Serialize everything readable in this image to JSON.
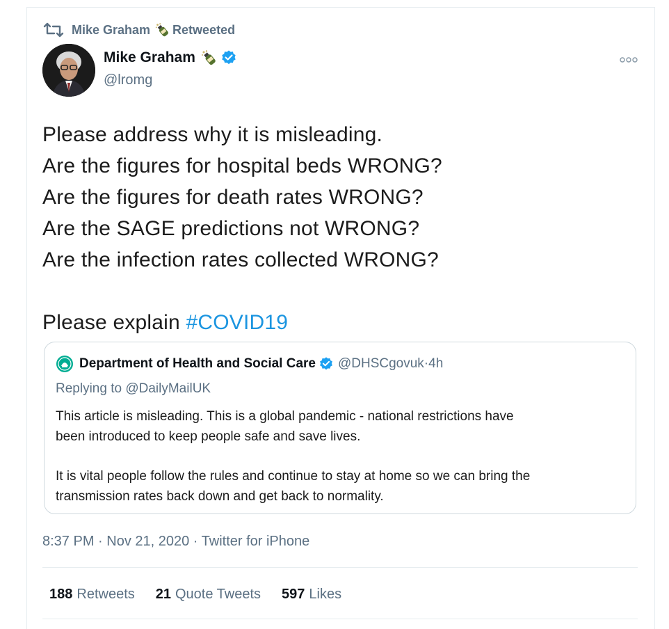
{
  "retweet_context": {
    "name": "Mike Graham",
    "label": "Retweeted"
  },
  "author": {
    "display_name": "Mike Graham",
    "handle": "@lromg"
  },
  "tweet": {
    "lines": [
      "Please address why it is misleading.",
      "Are the figures for hospital beds WRONG?",
      "Are the figures for death rates WRONG?",
      "Are the SAGE predictions not WRONG?",
      "Are the infection rates collected WRONG?"
    ],
    "closing_text": "Please explain ",
    "hashtag": "#COVID19"
  },
  "quoted_tweet": {
    "name": "Department of Health and Social Care",
    "handle": "@DHSCgovuk",
    "separator": " · ",
    "time": "4h",
    "replying_to": "Replying to @DailyMailUK",
    "paragraph1_line1": "This article is misleading. This is a global pandemic - national restrictions have",
    "paragraph1_line2": "been introduced to keep people safe and save lives.",
    "paragraph2_line1": "It is vital people follow the rules and continue to stay at home so we can bring the",
    "paragraph2_line2": "transmission rates back down and get back to normality."
  },
  "timestamp": "8:37 PM · Nov 21, 2020 · Twitter for iPhone",
  "stats": {
    "retweets_count": "188",
    "retweets_label": "Retweets",
    "quotes_count": "21",
    "quotes_label": "Quote Tweets",
    "likes_count": "597",
    "likes_label": "Likes"
  },
  "colors": {
    "accent": "#1b95e0",
    "secondary_text": "#5b7083",
    "verified": "#1da1f2"
  },
  "icons": [
    "retweet-icon",
    "bottle-emoji-icon",
    "verified-badge-icon",
    "more-options-icon",
    "dhsc-crest-icon"
  ]
}
